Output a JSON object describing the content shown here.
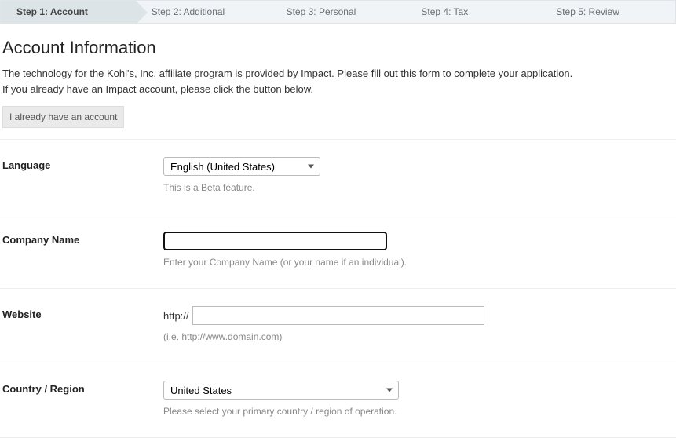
{
  "steps": {
    "s1": "Step 1: Account",
    "s2": "Step 2: Additional",
    "s3": "Step 3: Personal",
    "s4": "Step 4: Tax",
    "s5": "Step 5: Review"
  },
  "header": {
    "title": "Account Information",
    "desc1": "The technology for the Kohl's, Inc. affiliate program is provided by Impact. Please fill out this form to complete your application.",
    "desc2": "If you already have an Impact account, please click the button below.",
    "already_btn": "I already have an account"
  },
  "form": {
    "language": {
      "label": "Language",
      "value": "English (United States)",
      "hint": "This is a Beta feature."
    },
    "company": {
      "label": "Company Name",
      "value": "",
      "hint": "Enter your Company Name (or your name if an individual)."
    },
    "website": {
      "label": "Website",
      "prefix": "http://",
      "value": "",
      "hint": "(i.e. http://www.domain.com)"
    },
    "country": {
      "label": "Country / Region",
      "value": "United States",
      "hint": "Please select your primary country / region of operation."
    }
  }
}
